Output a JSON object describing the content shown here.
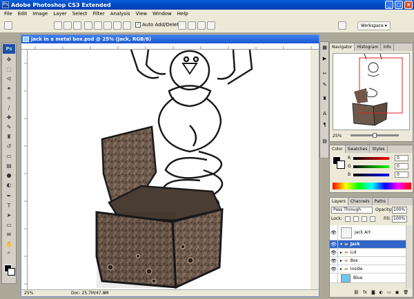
{
  "app": {
    "title": "Adobe Photoshop CS3 Extended",
    "logo": "Ps"
  },
  "menu": [
    "File",
    "Edit",
    "Image",
    "Layer",
    "Select",
    "Filter",
    "Analysis",
    "View",
    "Window",
    "Help"
  ],
  "options": {
    "auto_add_delete": "Auto Add/Delete",
    "workspace": "Workspace ▾"
  },
  "document": {
    "title": "jack in a metal box.psd @ 25% (Jack, RGB/8)",
    "zoom": "25%",
    "doc_size": "Doc: 25.7M/47.8M"
  },
  "navigator": {
    "tabs": [
      "Navigator",
      "Histogram",
      "Info"
    ],
    "zoom": "25%"
  },
  "color": {
    "tabs": [
      "Color",
      "Swatches",
      "Styles"
    ],
    "r_label": "R",
    "g_label": "G",
    "b_label": "B",
    "r": "0",
    "g": "0",
    "b": "0"
  },
  "layers": {
    "tabs": [
      "Layers",
      "Channels",
      "Paths"
    ],
    "blend_mode": "Pass Through",
    "opacity_label": "Opacity:",
    "opacity": "100%",
    "lock_label": "Lock:",
    "fill_label": "Fill:",
    "fill": "100%",
    "items": [
      {
        "name": "Jack Art"
      },
      {
        "name": "Jack"
      },
      {
        "name": "Lid"
      },
      {
        "name": "Box"
      },
      {
        "name": "Inside"
      },
      {
        "name": "Blue"
      }
    ]
  },
  "colors": {
    "titlebar": "#0a5fd8",
    "selected_layer": "#3166c8",
    "chrome": "#ece9d8"
  }
}
